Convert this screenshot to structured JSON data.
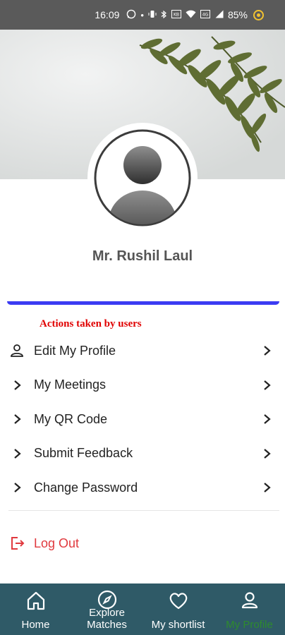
{
  "status_bar": {
    "time": "16:09",
    "battery": "85%"
  },
  "profile": {
    "name": "Mr. Rushil Laul"
  },
  "section_note": "Actions taken by users",
  "menu": [
    {
      "label": "Edit My Profile",
      "icon": "person-icon"
    },
    {
      "label": "My Meetings",
      "icon": "chevron-right-icon"
    },
    {
      "label": "My QR Code",
      "icon": "chevron-right-icon"
    },
    {
      "label": "Submit Feedback",
      "icon": "chevron-right-icon"
    },
    {
      "label": "Change Password",
      "icon": "chevron-right-icon"
    }
  ],
  "logout": {
    "label": "Log Out",
    "color": "#e0393e"
  },
  "bottom_nav": [
    {
      "label": "Home",
      "icon": "home-icon",
      "active": false
    },
    {
      "label": "Explore\nMatches",
      "line1": "Explore",
      "line2": "Matches",
      "icon": "compass-icon",
      "active": false
    },
    {
      "label": "My shortlist",
      "icon": "heart-icon",
      "active": false
    },
    {
      "label": "My Profile",
      "icon": "person-icon",
      "active": true
    }
  ],
  "colors": {
    "nav_bg": "#2f5a67",
    "accent_blue": "#3b3bf2",
    "note_red": "#e00000",
    "active_green": "#2e8b2e"
  }
}
